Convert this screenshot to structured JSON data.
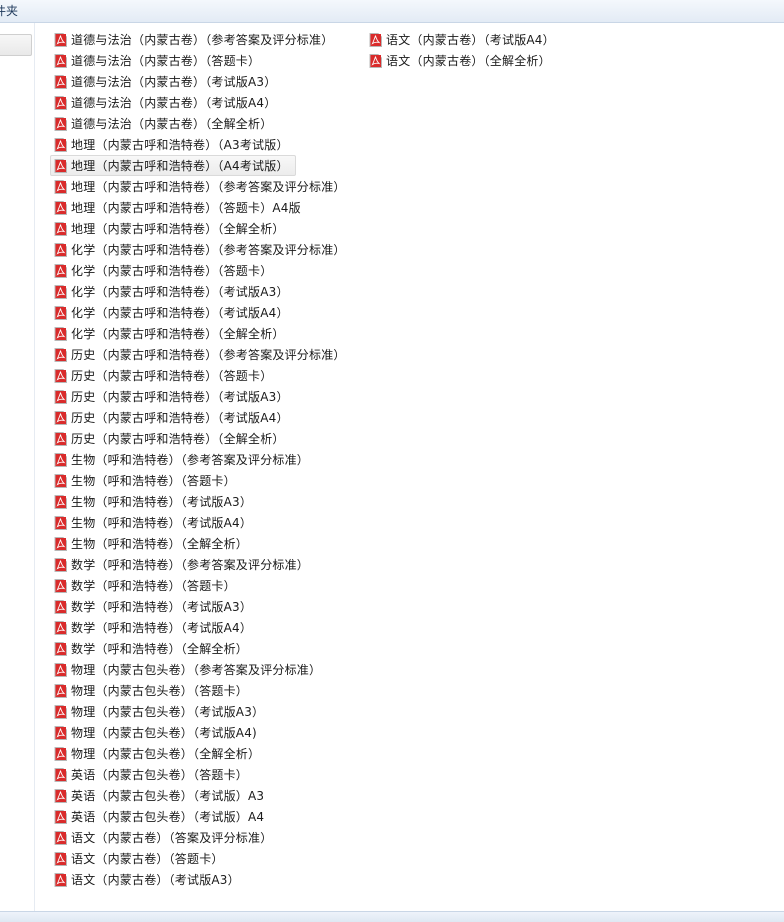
{
  "window": {
    "title": "件夹"
  },
  "files_col1": [
    "道德与法治（内蒙古卷）（参考答案及评分标准）",
    "道德与法治（内蒙古卷）（答题卡）",
    "道德与法治（内蒙古卷）（考试版A3）",
    "道德与法治（内蒙古卷）（考试版A4）",
    "道德与法治（内蒙古卷）（全解全析）",
    "地理（内蒙古呼和浩特卷）（A3考试版）",
    "地理（内蒙古呼和浩特卷）（A4考试版）",
    "地理（内蒙古呼和浩特卷）（参考答案及评分标准）",
    "地理（内蒙古呼和浩特卷）（答题卡）A4版",
    "地理（内蒙古呼和浩特卷）（全解全析）",
    "化学（内蒙古呼和浩特卷）（参考答案及评分标准）",
    "化学（内蒙古呼和浩特卷）（答题卡）",
    "化学（内蒙古呼和浩特卷）（考试版A3）",
    "化学（内蒙古呼和浩特卷）（考试版A4）",
    "化学（内蒙古呼和浩特卷）（全解全析）",
    "历史（内蒙古呼和浩特卷）（参考答案及评分标准）",
    "历史（内蒙古呼和浩特卷）（答题卡）",
    "历史（内蒙古呼和浩特卷）（考试版A3）",
    "历史（内蒙古呼和浩特卷）（考试版A4）",
    "历史（内蒙古呼和浩特卷）（全解全析）",
    "生物（呼和浩特卷）（参考答案及评分标准）",
    "生物（呼和浩特卷）（答题卡）",
    "生物（呼和浩特卷）（考试版A3）",
    "生物（呼和浩特卷）（考试版A4）",
    "生物（呼和浩特卷）（全解全析）",
    "数学（呼和浩特卷）（参考答案及评分标准）",
    "数学（呼和浩特卷）（答题卡）",
    "数学（呼和浩特卷）（考试版A3）",
    "数学（呼和浩特卷）（考试版A4）",
    "数学（呼和浩特卷）（全解全析）",
    "物理（内蒙古包头卷）（参考答案及评分标准）",
    "物理（内蒙古包头卷）（答题卡）",
    "物理（内蒙古包头卷）（考试版A3）",
    "物理（内蒙古包头卷）（考试版A4)",
    "物理（内蒙古包头卷）（全解全析）",
    "英语（内蒙古包头卷）（答题卡）",
    "英语（内蒙古包头卷）（考试版）A3",
    "英语（内蒙古包头卷）（考试版）A4",
    "语文（内蒙古卷）（答案及评分标准）",
    "语文（内蒙古卷）（答题卡）",
    "语文（内蒙古卷）（考试版A3）"
  ],
  "files_col2": [
    "语文（内蒙古卷）（考试版A4）",
    "语文（内蒙古卷）（全解全析）"
  ],
  "hovered_index": 6,
  "icon": "pdf-file-icon",
  "colors": {
    "pdf_red": "#d21f1f",
    "hover_bg": "#ececec"
  }
}
